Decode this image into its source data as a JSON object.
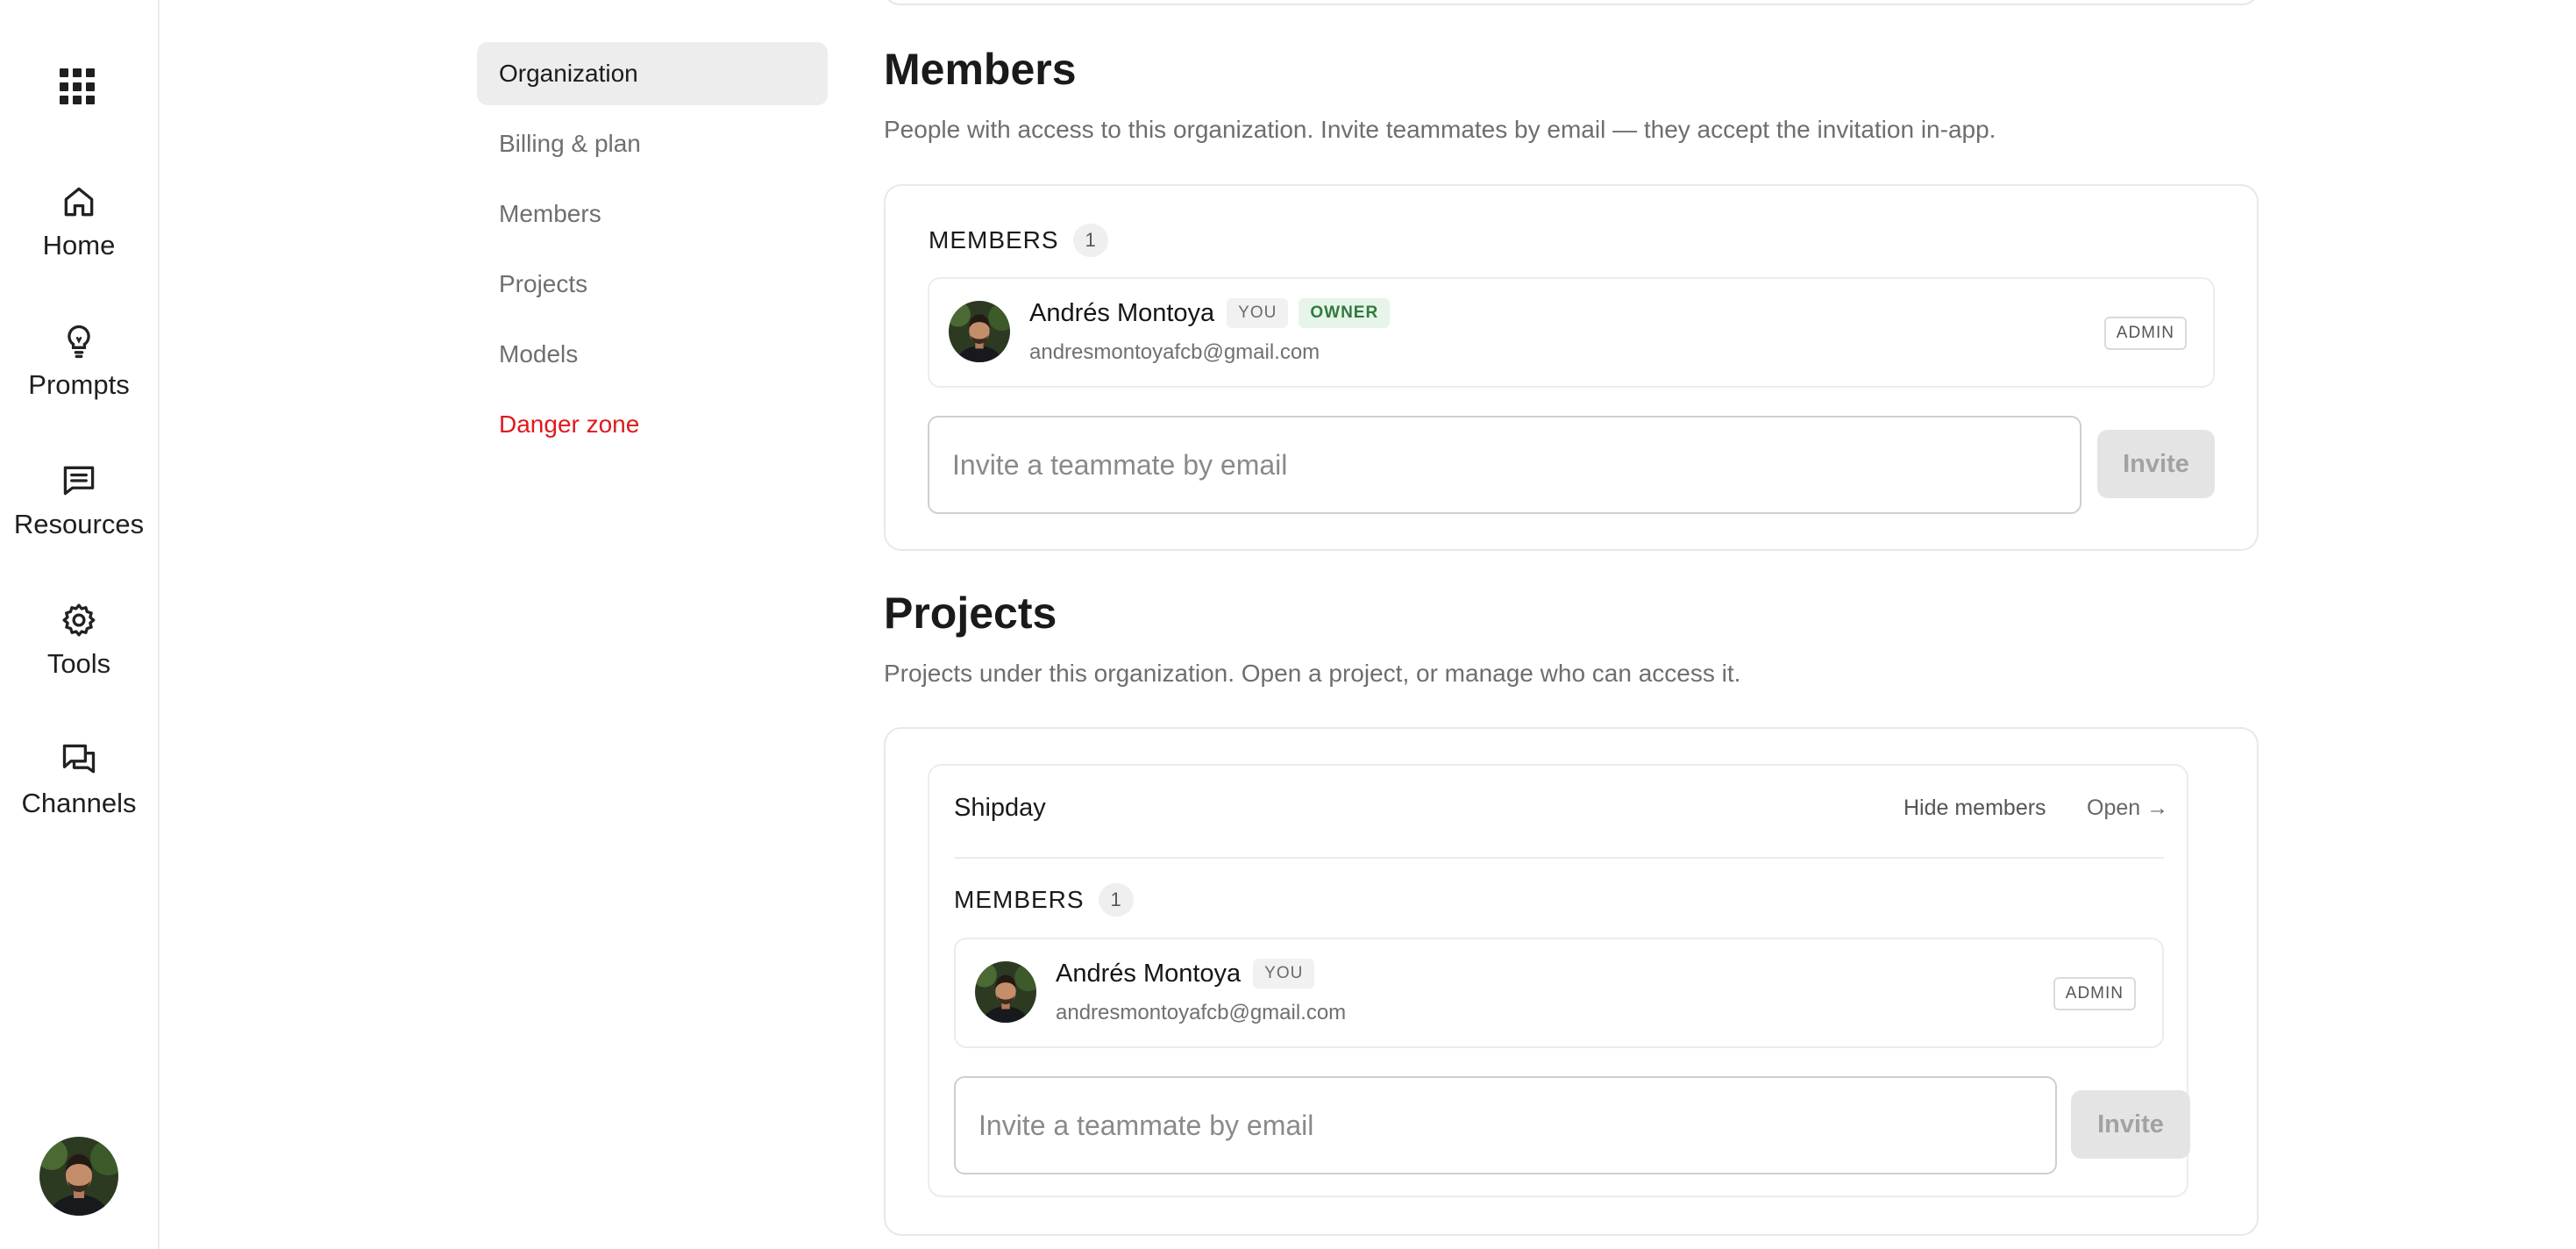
{
  "rail": {
    "items": [
      {
        "label": "Home",
        "icon": "home-icon"
      },
      {
        "label": "Prompts",
        "icon": "lightbulb-icon"
      },
      {
        "label": "Resources",
        "icon": "message-square-icon"
      },
      {
        "label": "Tools",
        "icon": "gear-icon"
      },
      {
        "label": "Channels",
        "icon": "chat-bubbles-icon"
      }
    ]
  },
  "settings_nav": {
    "items": [
      {
        "label": "Organization",
        "active": true
      },
      {
        "label": "Billing & plan"
      },
      {
        "label": "Members"
      },
      {
        "label": "Projects"
      },
      {
        "label": "Models"
      },
      {
        "label": "Danger zone",
        "danger": true
      }
    ]
  },
  "members_section": {
    "title": "Members",
    "description": "People with access to this organization. Invite teammates by email — they accept the invitation in-app.",
    "list_header": "MEMBERS",
    "count": "1",
    "member": {
      "name": "Andrés Montoya",
      "you_badge": "YOU",
      "owner_badge": "OWNER",
      "email": "andresmontoyafcb@gmail.com",
      "role": "ADMIN"
    },
    "invite": {
      "placeholder": "Invite a teammate by email",
      "button": "Invite"
    }
  },
  "projects_section": {
    "title": "Projects",
    "description": "Projects under this organization. Open a project, or manage who can access it.",
    "project": {
      "name": "Shipday",
      "hide_members": "Hide members",
      "open": "Open →",
      "list_header": "MEMBERS",
      "count": "1",
      "member": {
        "name": "Andrés Montoya",
        "you_badge": "YOU",
        "email": "andresmontoyafcb@gmail.com",
        "role": "ADMIN"
      },
      "invite": {
        "placeholder": "Invite a teammate by email",
        "button": "Invite"
      }
    }
  },
  "colors": {
    "danger": "#e0191d",
    "owner_badge_bg": "#e7f4e9",
    "owner_badge_text": "#2f7b3c",
    "nav_active_bg": "#ededed"
  }
}
